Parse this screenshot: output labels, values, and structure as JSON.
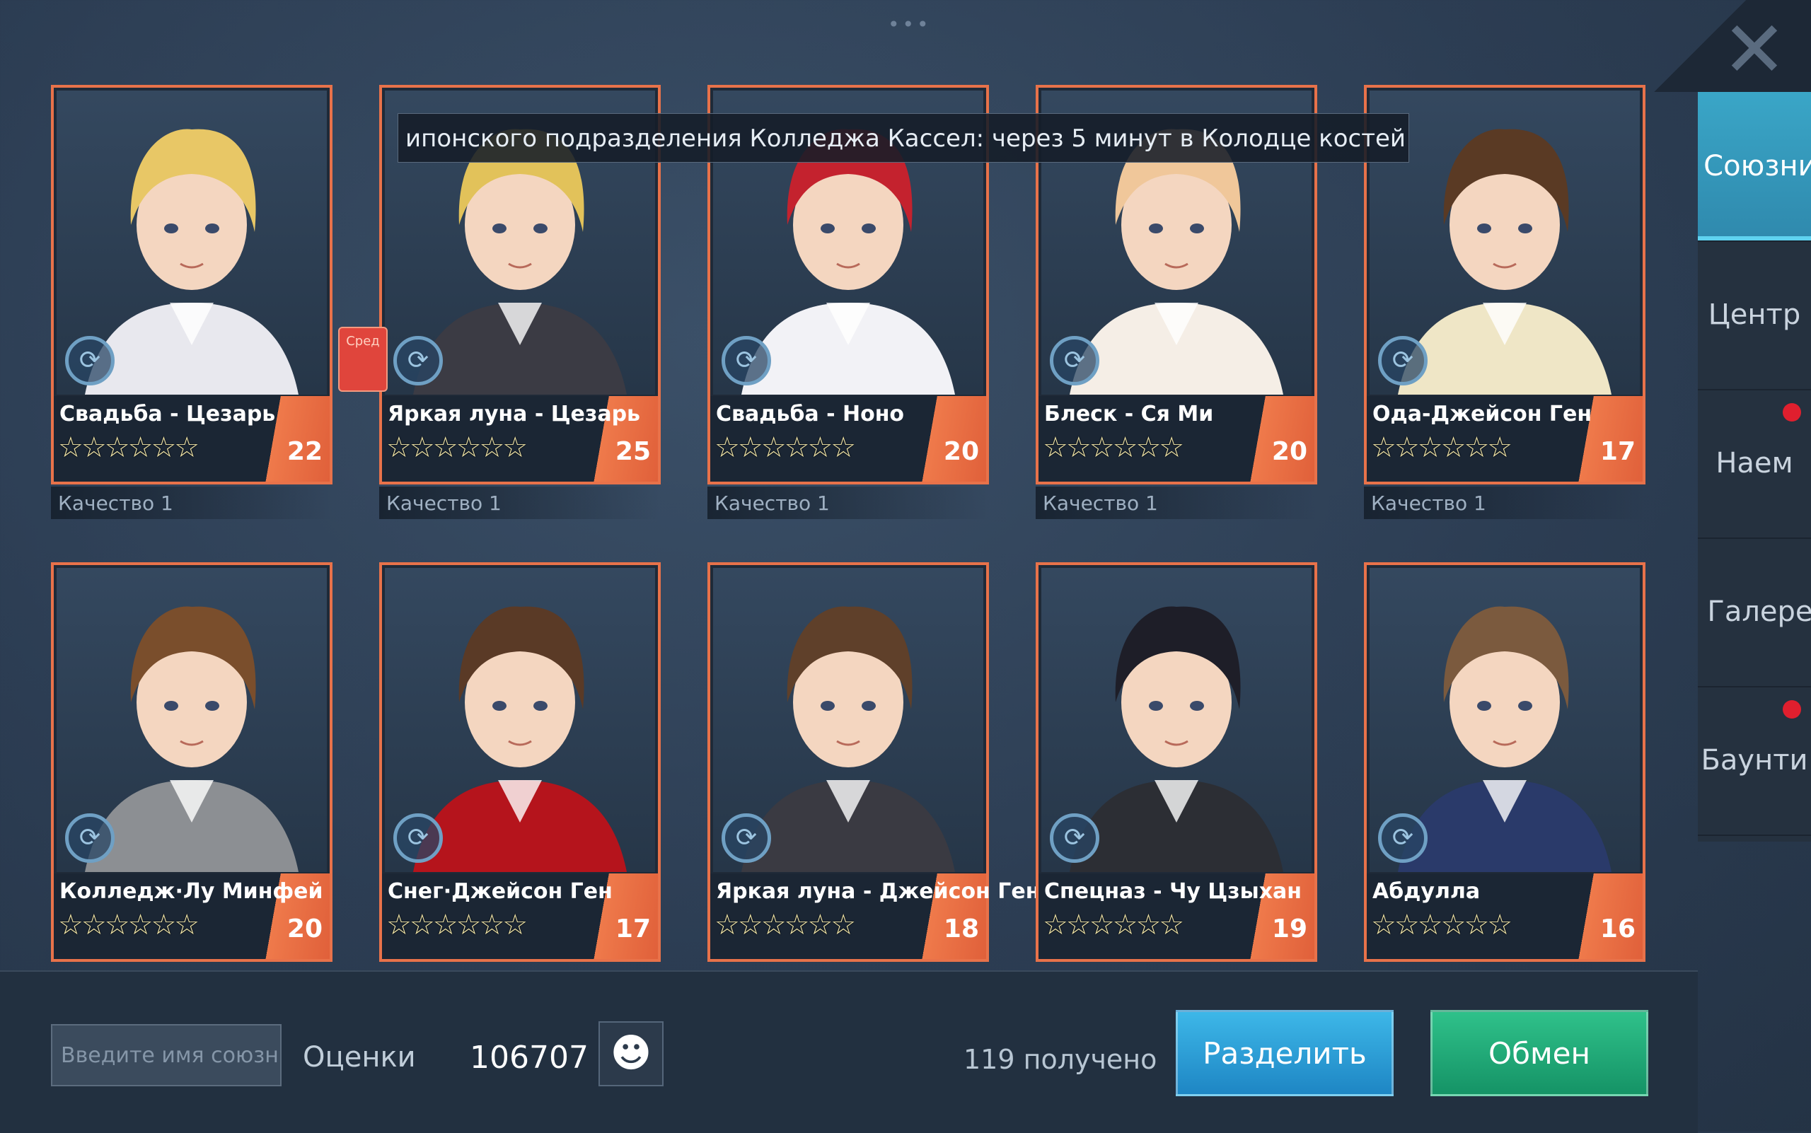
{
  "window": {
    "close_icon": "close-icon",
    "more_icon": "more-dots-icon"
  },
  "ticker": {
    "text": "ипонского подразделения Колледжа Кассел: через 5 минут в Колодце костей произойд"
  },
  "sidebar": {
    "tabs": [
      {
        "label": "Союзник",
        "active": true,
        "dot": false
      },
      {
        "label": "Центр",
        "active": false,
        "dot": false
      },
      {
        "label": "Наем",
        "active": false,
        "dot": true
      },
      {
        "label": "Галерея",
        "active": false,
        "dot": false
      },
      {
        "label": "Баунти",
        "active": false,
        "dot": true
      }
    ]
  },
  "cards": [
    {
      "name": "Свадьба - Цезарь",
      "stars": "☆☆☆☆☆☆",
      "level": "22",
      "quality": "Качество 1",
      "hair": "#e8c766",
      "outfit": "#e8e8ee"
    },
    {
      "name": "Яркая луна - Цезарь",
      "stars": "☆☆☆☆☆☆",
      "level": "25",
      "quality": "Качество 1",
      "hair": "#e2c25a",
      "outfit": "#3b3b44"
    },
    {
      "name": "Свадьба - Ноно",
      "stars": "☆☆☆☆☆☆",
      "level": "20",
      "quality": "Качество 1",
      "hair": "#c4222e",
      "outfit": "#f2f2f6"
    },
    {
      "name": "Блеск - Ся Ми",
      "stars": "☆☆☆☆☆☆",
      "level": "20",
      "quality": "Качество 1",
      "hair": "#f0c79a",
      "outfit": "#f5eee6"
    },
    {
      "name": "Ода-Джейсон Ген",
      "stars": "☆☆☆☆☆☆",
      "level": "17",
      "quality": "Качество 1",
      "hair": "#5a3a24",
      "outfit": "#efe6c6"
    },
    {
      "name": "Колледж·Лу Минфей",
      "stars": "☆☆☆☆☆☆",
      "level": "20",
      "quality": "",
      "hair": "#7a4e2c",
      "outfit": "#8c8f93"
    },
    {
      "name": "Снег·Джейсон Ген",
      "stars": "☆☆☆☆☆☆",
      "level": "17",
      "quality": "",
      "hair": "#5a3a26",
      "outfit": "#b5141c"
    },
    {
      "name": "Яркая луна - Джейсон Ген",
      "stars": "☆☆☆☆☆☆",
      "level": "18",
      "quality": "",
      "hair": "#5f402a",
      "outfit": "#3a3a42"
    },
    {
      "name": "Спецназ - Чу Цзыхан",
      "stars": "☆☆☆☆☆☆",
      "level": "19",
      "quality": "",
      "hair": "#1e1e28",
      "outfit": "#2c2e34"
    },
    {
      "name": "Абдулла",
      "stars": "☆☆☆☆☆☆",
      "level": "16",
      "quality": "",
      "hair": "#7b5a3e",
      "outfit": "#2a3a6a"
    }
  ],
  "red_tag": {
    "text": "Сред"
  },
  "bottom": {
    "search_placeholder": "Введите имя союзн",
    "score_label": "Оценки",
    "score_value": "106707",
    "received": "119 получено",
    "split_button": "Разделить",
    "trade_button": "Обмен"
  },
  "colors": {
    "card_border": "#e8724a",
    "accent_blue": "#3aa6c7",
    "button_split": "#2a9ed8",
    "button_trade": "#21a877"
  }
}
